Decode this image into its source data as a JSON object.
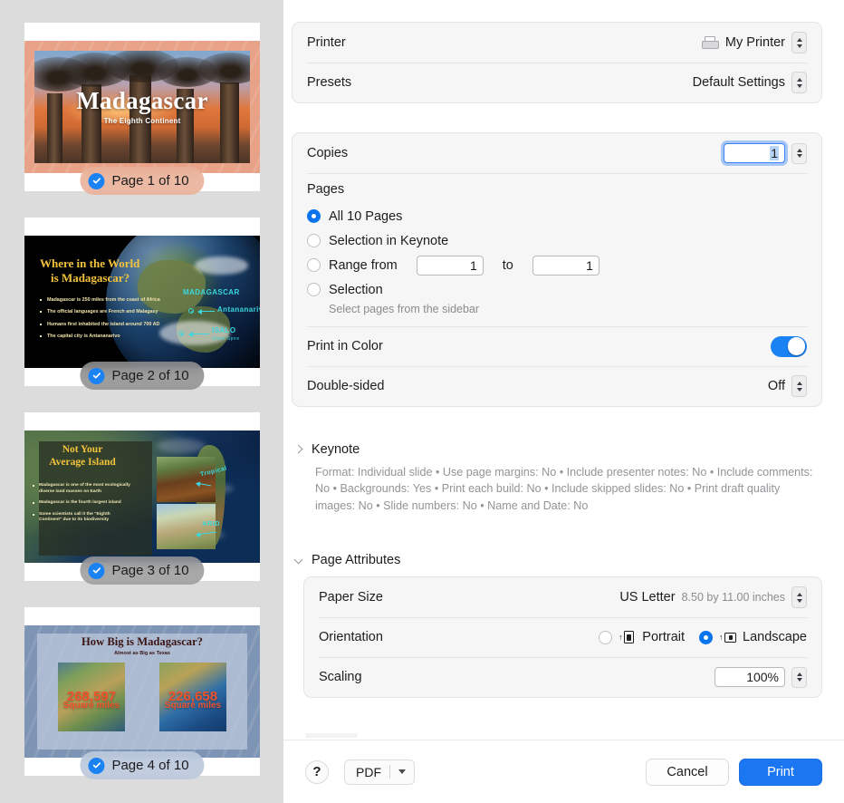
{
  "sidebar": {
    "pages": [
      {
        "badge": "Page 1 of 10",
        "title": "Madagascar",
        "subtitle": "The Eighth Continent"
      },
      {
        "badge": "Page 2 of 10",
        "title_line1": "Where in the World",
        "title_line2": "is Madagascar?",
        "bullets": [
          "Madagascar is 250 miles from the coast of Africa",
          "The official languages are French and Malagasy",
          "Humans first inhabited the island around 700 AD",
          "The capital city is Antananarivo"
        ],
        "annotations": [
          "MADAGASCAR",
          "Antananarivo",
          "ISALO",
          "Stone Spire"
        ]
      },
      {
        "badge": "Page 3 of 10",
        "title_line1": "Not Your",
        "title_line2": "Average Island",
        "bullets": [
          "Madagascar is one of the most ecologically diverse land masses on Earth",
          "Madagascar is the fourth largest island",
          "Some scientists call it the \"Eighth Continent\" due to its biodiversity"
        ],
        "annotations": [
          "Tropical",
          "ARID"
        ]
      },
      {
        "badge": "Page 4 of 10",
        "title": "How Big is Madagascar?",
        "subtitle": "Almost as Big as Texas",
        "stats": [
          {
            "number": "268,597",
            "unit": "Square miles"
          },
          {
            "number": "226,658",
            "unit": "Square miles"
          }
        ]
      }
    ]
  },
  "printer_group": {
    "printer_label": "Printer",
    "printer_value": "My Printer",
    "presets_label": "Presets",
    "presets_value": "Default Settings"
  },
  "options_group": {
    "copies_label": "Copies",
    "copies_value": "1",
    "pages_label": "Pages",
    "radios": [
      {
        "label": "All 10 Pages",
        "selected": true
      },
      {
        "label": "Selection in Keynote",
        "selected": false
      },
      {
        "label": "Range from",
        "selected": false
      },
      {
        "label": "Selection",
        "selected": false
      }
    ],
    "range_from_value": "1",
    "range_to_label": "to",
    "range_to_value": "1",
    "selection_hint": "Select pages from the sidebar",
    "print_color_label": "Print in Color",
    "print_color_on": true,
    "double_sided_label": "Double-sided",
    "double_sided_value": "Off"
  },
  "keynote_section": {
    "title": "Keynote",
    "expanded": false,
    "description": "Format: Individual slide • Use page margins: No • Include presenter notes: No • Include comments: No • Backgrounds: Yes • Print each build: No • Include skipped slides: No • Print draft quality images: No • Slide numbers: No • Name and Date: No"
  },
  "page_attributes_section": {
    "title": "Page Attributes",
    "expanded": true,
    "paper_size_label": "Paper Size",
    "paper_size_value": "US Letter",
    "paper_size_dimensions": "8.50 by 11.00 inches",
    "orientation_label": "Orientation",
    "orientation_portrait": "Portrait",
    "orientation_landscape": "Landscape",
    "orientation_selected": "Landscape",
    "scaling_label": "Scaling",
    "scaling_value": "100%"
  },
  "footer": {
    "help_label": "?",
    "pdf_label": "PDF",
    "cancel_label": "Cancel",
    "print_label": "Print"
  },
  "colors": {
    "accent_blue": "#1b76f2",
    "toggle_on": "#1b82f3",
    "radio_selected": "#0a74ec"
  }
}
